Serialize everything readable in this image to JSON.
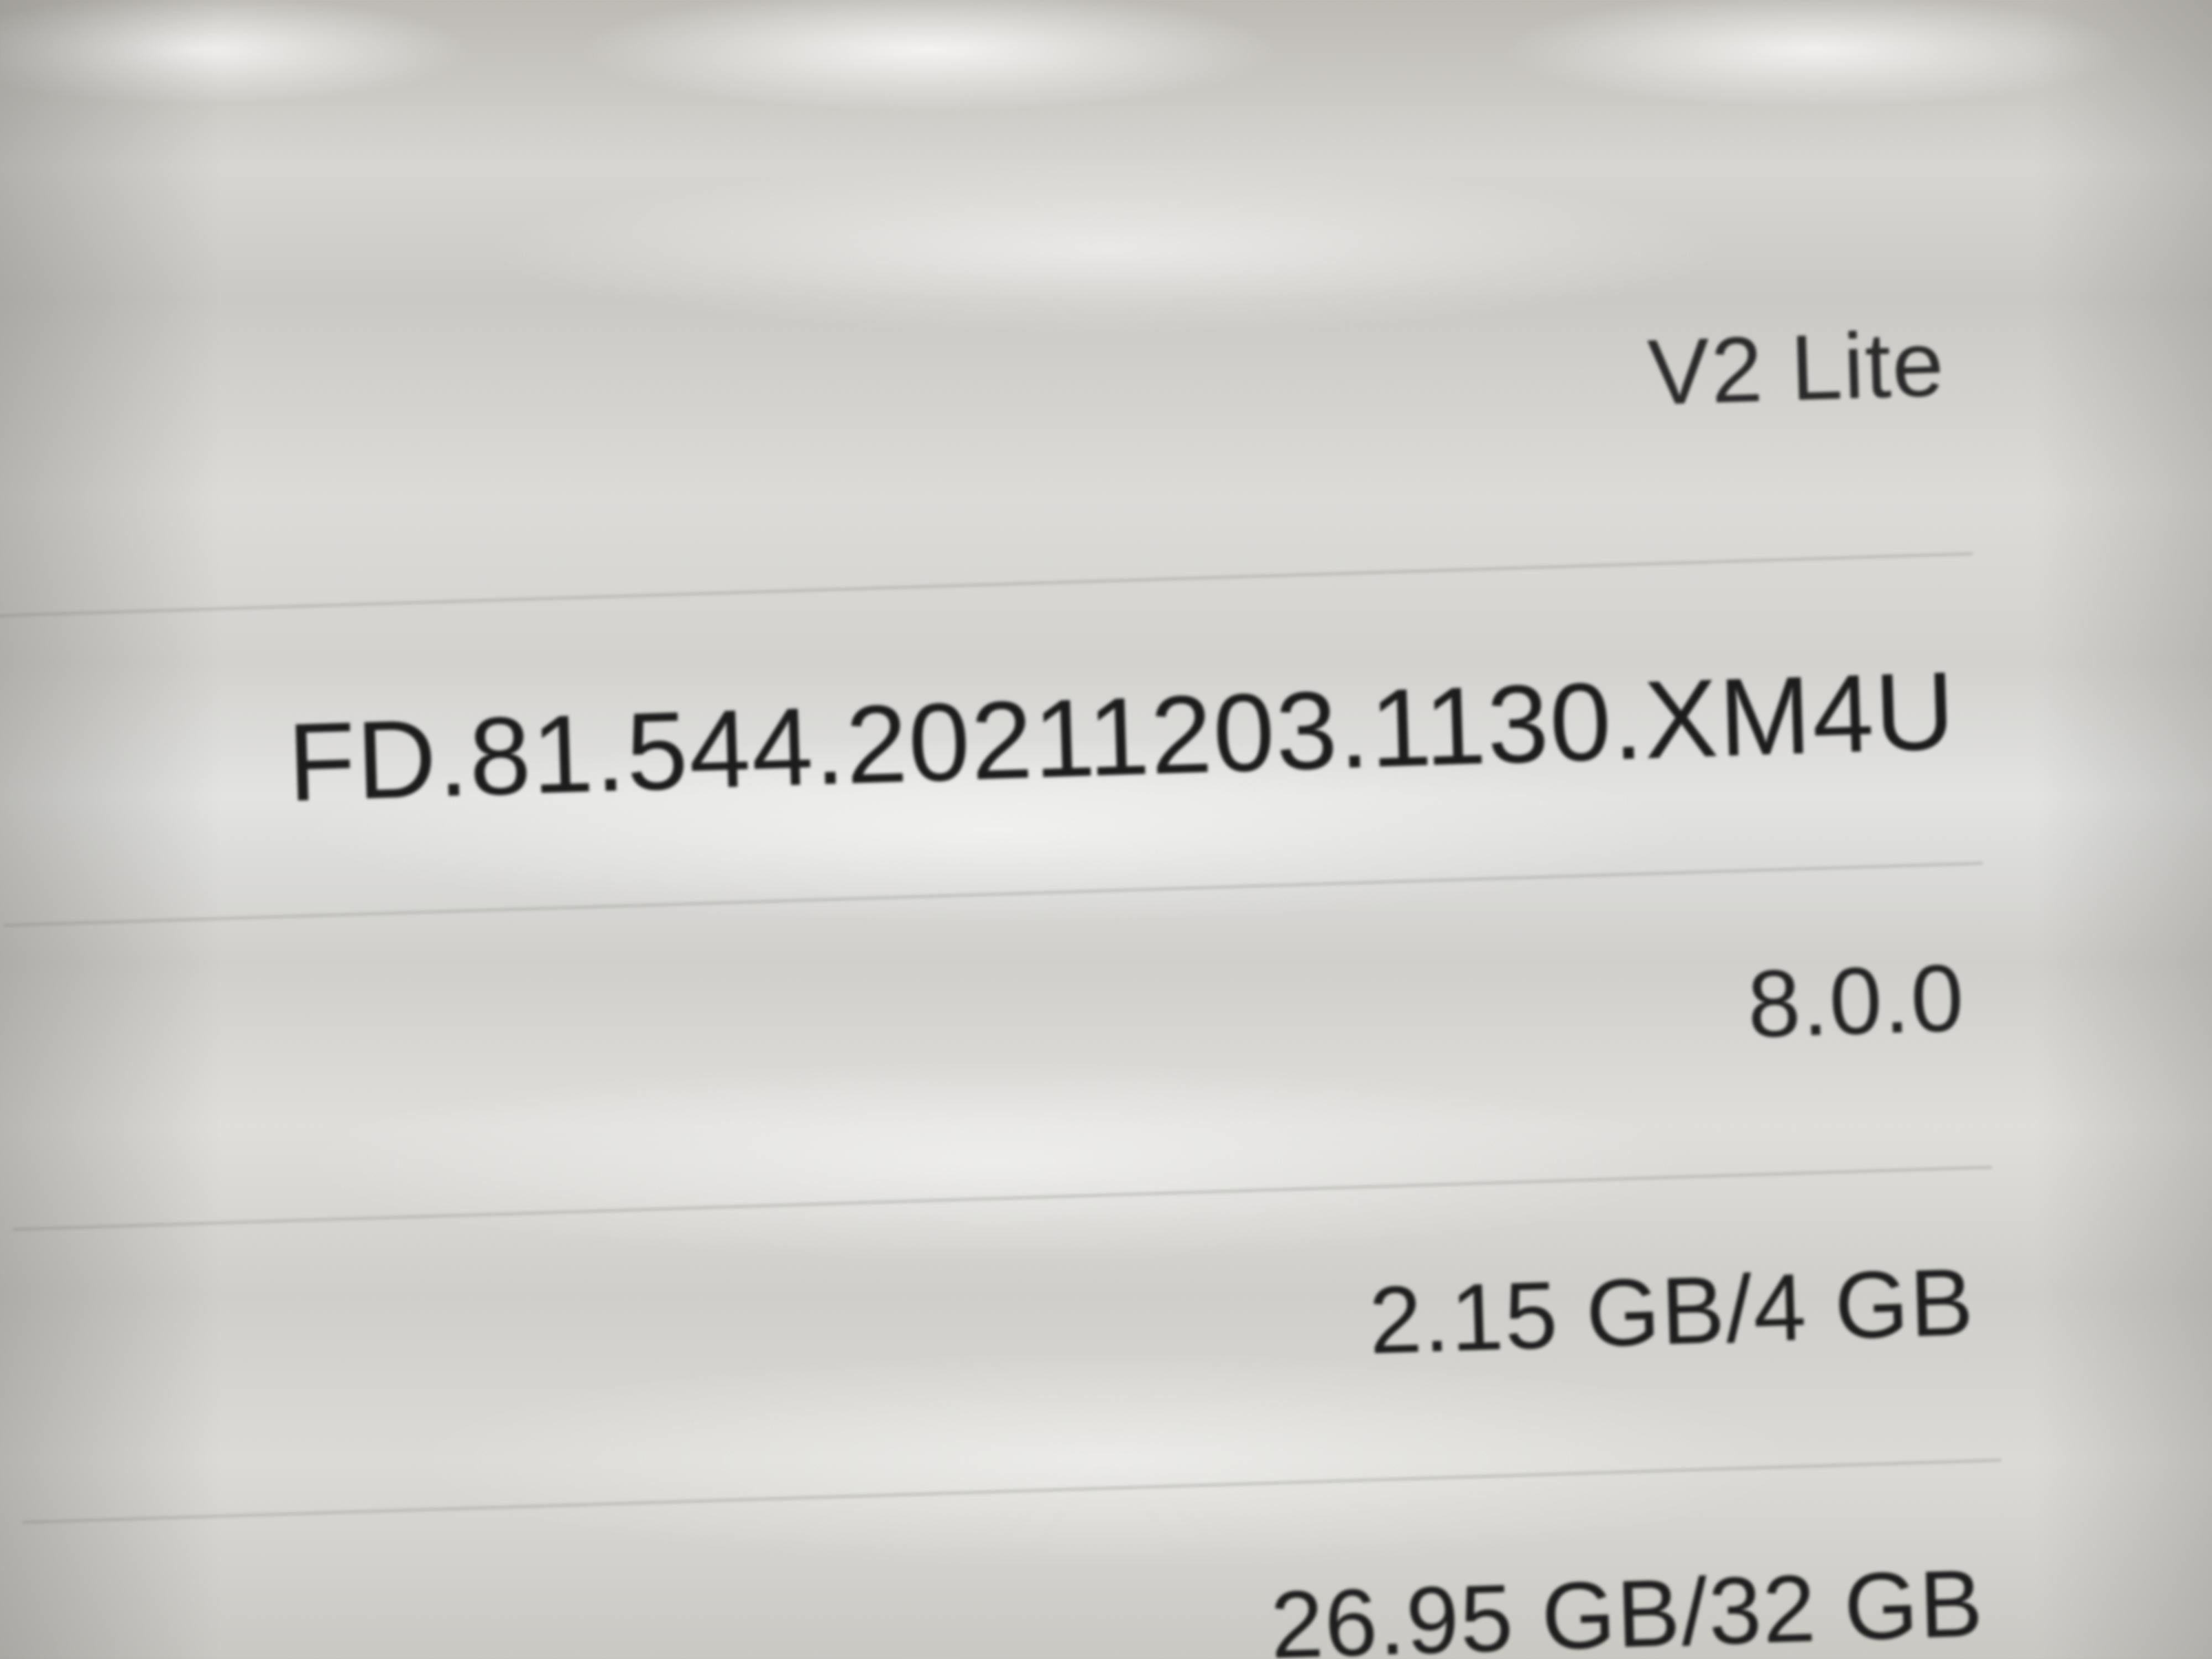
{
  "settings_list": {
    "rows": [
      {
        "value": "V2 Lite"
      },
      {
        "value": "FD.81.544.20211203.1130.XM4U"
      },
      {
        "value": "8.0.0"
      },
      {
        "value": "2.15 GB/4 GB"
      },
      {
        "value": "26.95 GB/32 GB"
      }
    ]
  }
}
